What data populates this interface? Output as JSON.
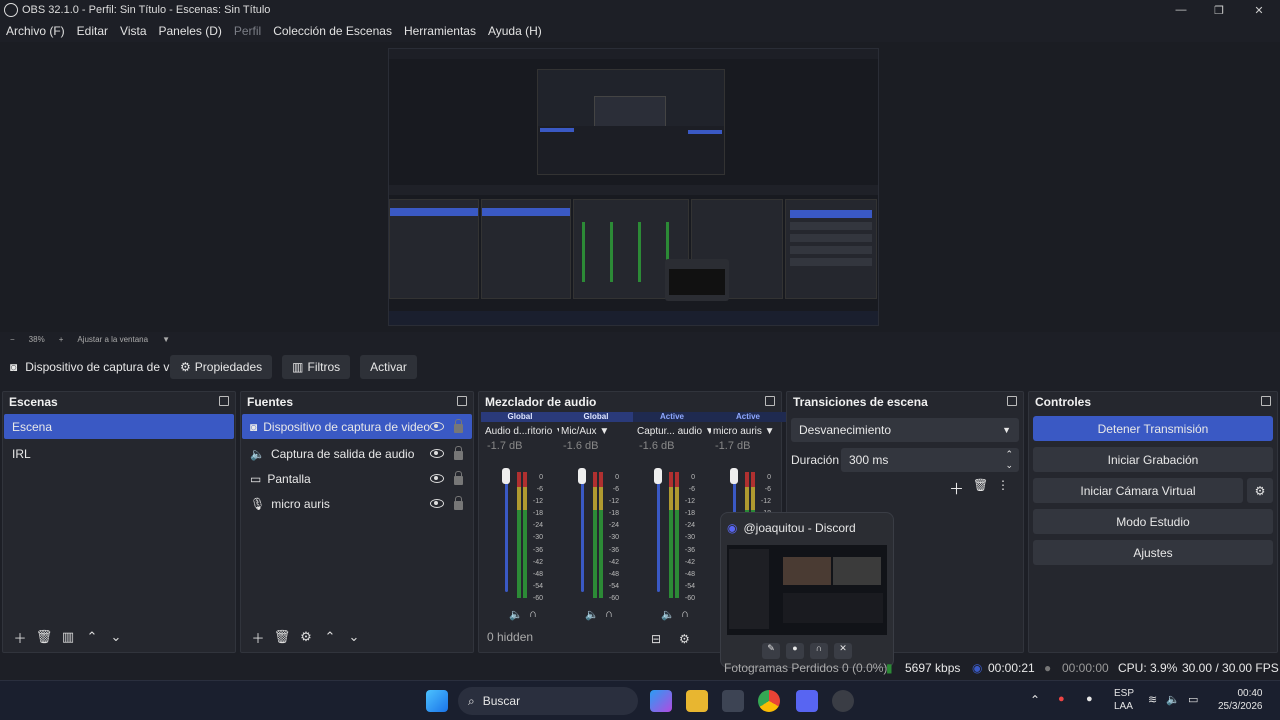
{
  "window": {
    "title": "OBS 32.1.0 - Perfil: Sin Título - Escenas: Sin Título"
  },
  "menu": [
    "Archivo (F)",
    "Editar",
    "Vista",
    "Paneles (D)",
    "Perfil",
    "Colección de Escenas",
    "Herramientas",
    "Ayuda (H)"
  ],
  "zoom": {
    "minus": "−",
    "value": "38%",
    "plus": "+",
    "fit": "Ajustar a la ventana"
  },
  "source_bar": {
    "selected": "Dispositivo de captura de v",
    "properties": "Propiedades",
    "filters": "Filtros",
    "activate": "Activar"
  },
  "scenes": {
    "title": "Escenas",
    "items": [
      "Escena",
      "IRL"
    ]
  },
  "sources": {
    "title": "Fuentes",
    "items": [
      "Dispositivo de captura de video",
      "Captura de salida de audio",
      "Pantalla",
      "micro auris"
    ]
  },
  "mixer": {
    "title": "Mezclador de audio",
    "hidden": "0 hidden",
    "channels": [
      {
        "tag": "Global",
        "name": "Audio d...ritorio",
        "db": "-1.7 dB"
      },
      {
        "tag": "Global",
        "name": "Mic/Aux",
        "db": "-1.6 dB"
      },
      {
        "tag": "Active",
        "name": "Captur... audio",
        "db": "-1.6 dB"
      },
      {
        "tag": "Active",
        "name": "micro auris",
        "db": "-1.7 dB"
      }
    ],
    "scale": [
      "0",
      "-6",
      "-12",
      "-18",
      "-24",
      "-30",
      "-36",
      "-42",
      "-48",
      "-54",
      "-60"
    ]
  },
  "transitions": {
    "title": "Transiciones de escena",
    "type": "Desvanecimiento",
    "duration_label": "Duración",
    "duration": "300 ms"
  },
  "controls": {
    "title": "Controles",
    "stop_stream": "Detener Transmisión",
    "start_rec": "Iniciar Grabación",
    "virtual_cam": "Iniciar Cámara Virtual",
    "studio": "Modo Estudio",
    "settings": "Ajustes"
  },
  "discord": {
    "title": "@joaquitou - Discord"
  },
  "status": {
    "dropped": "Fotogramas Perdidos 0 (0.0%)",
    "kbps": "5697 kbps",
    "stream_time": "00:00:21",
    "rec_time": "00:00:00",
    "cpu": "CPU: 3.9%",
    "fps": "30.00 / 30.00 FPS"
  },
  "taskbar": {
    "search": "Buscar",
    "lang1": "ESP",
    "lang2": "LAA",
    "time": "00:40",
    "date": "25/3/2026"
  },
  "colors": {
    "accent": "#3a59c4",
    "panel": "#25272e",
    "bg": "#1d1f26"
  }
}
